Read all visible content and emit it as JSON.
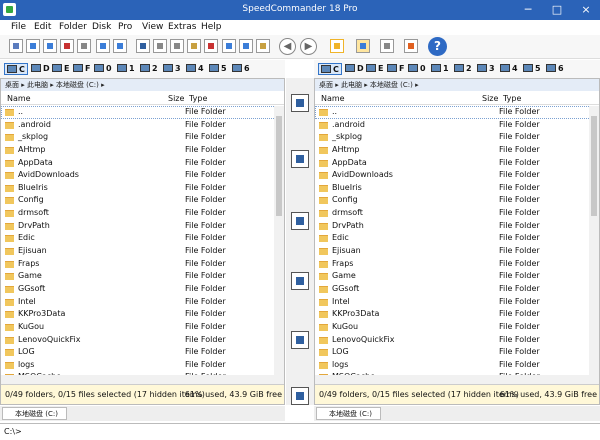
{
  "window": {
    "title": "SpeedCommander 18 Pro",
    "minimize": "─",
    "maximize": "□",
    "close": "×"
  },
  "menu": {
    "items": [
      "File",
      "Edit",
      "Folder",
      "Disk",
      "Pro",
      "View",
      "Extras",
      "Help"
    ]
  },
  "toolbar": {
    "help": "?"
  },
  "drives": [
    {
      "label": "C"
    },
    {
      "label": "D"
    },
    {
      "label": "E"
    },
    {
      "label": "F"
    },
    {
      "label": "0"
    },
    {
      "label": "1"
    },
    {
      "label": "2"
    },
    {
      "label": "3"
    },
    {
      "label": "4"
    },
    {
      "label": "5"
    },
    {
      "label": "6"
    }
  ],
  "panels": [
    {
      "breadcrumb": "桌面 ▸ 此电脑 ▸ 本地磁盘 (C:) ▸",
      "headers": {
        "name": "Name",
        "size": "Size",
        "type": "Type"
      },
      "rows": [
        [
          "..",
          "File Folder"
        ],
        [
          ".android",
          "File Folder"
        ],
        [
          "_skplog",
          "File Folder"
        ],
        [
          "AHtmp",
          "File Folder"
        ],
        [
          "AppData",
          "File Folder"
        ],
        [
          "AvidDownloads",
          "File Folder"
        ],
        [
          "BlueIris",
          "File Folder"
        ],
        [
          "Config",
          "File Folder"
        ],
        [
          "drmsoft",
          "File Folder"
        ],
        [
          "DrvPath",
          "File Folder"
        ],
        [
          "Edic",
          "File Folder"
        ],
        [
          "Ejisuan",
          "File Folder"
        ],
        [
          "Fraps",
          "File Folder"
        ],
        [
          "Game",
          "File Folder"
        ],
        [
          "GGsoft",
          "File Folder"
        ],
        [
          "Intel",
          "File Folder"
        ],
        [
          "KKPro3Data",
          "File Folder"
        ],
        [
          "KuGou",
          "File Folder"
        ],
        [
          "LenovoQuickFix",
          "File Folder"
        ],
        [
          "LOG",
          "File Folder"
        ],
        [
          "logs",
          "File Folder"
        ],
        [
          "MSOCache",
          "File Folder"
        ]
      ],
      "status_left": "0/49 folders, 0/15 files selected (17 hidden items)",
      "status_right": "61% used, 43.9 GiB free",
      "tab": "本地磁盘 (C:)"
    },
    {
      "breadcrumb": "桌面 ▸ 此电脑 ▸ 本地磁盘 (C:) ▸",
      "headers": {
        "name": "Name",
        "size": "Size",
        "type": "Type"
      },
      "rows": [
        [
          "..",
          "File Folder"
        ],
        [
          ".android",
          "File Folder"
        ],
        [
          "_skplog",
          "File Folder"
        ],
        [
          "AHtmp",
          "File Folder"
        ],
        [
          "AppData",
          "File Folder"
        ],
        [
          "AvidDownloads",
          "File Folder"
        ],
        [
          "BlueIris",
          "File Folder"
        ],
        [
          "Config",
          "File Folder"
        ],
        [
          "drmsoft",
          "File Folder"
        ],
        [
          "DrvPath",
          "File Folder"
        ],
        [
          "Edic",
          "File Folder"
        ],
        [
          "Ejisuan",
          "File Folder"
        ],
        [
          "Fraps",
          "File Folder"
        ],
        [
          "Game",
          "File Folder"
        ],
        [
          "GGsoft",
          "File Folder"
        ],
        [
          "Intel",
          "File Folder"
        ],
        [
          "KKPro3Data",
          "File Folder"
        ],
        [
          "KuGou",
          "File Folder"
        ],
        [
          "LenovoQuickFix",
          "File Folder"
        ],
        [
          "LOG",
          "File Folder"
        ],
        [
          "logs",
          "File Folder"
        ],
        [
          "MSOCache",
          "File Folder"
        ]
      ],
      "status_left": "0/49 folders, 0/15 files selected (17 hidden items)",
      "status_right": "61% used, 43.9 GiB free",
      "tab": "本地磁盘 (C:)"
    }
  ],
  "command_line": "C:\\>"
}
